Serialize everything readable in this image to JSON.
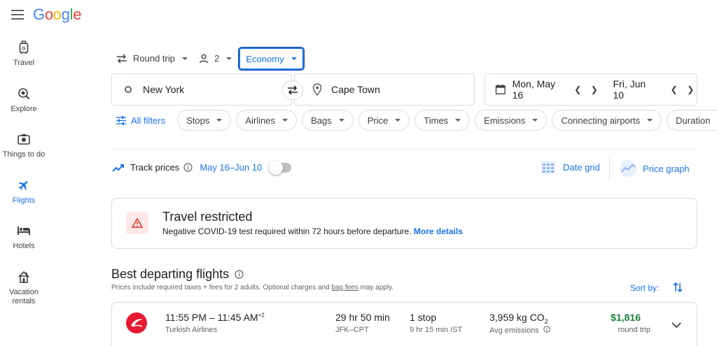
{
  "logo": {
    "letters": [
      "G",
      "o",
      "o",
      "g",
      "l",
      "e"
    ],
    "colors": [
      "#4285f4",
      "#ea4335",
      "#fbbc05",
      "#4285f4",
      "#34a853",
      "#ea4335"
    ]
  },
  "sidebar": {
    "items": [
      {
        "label": "Travel",
        "icon": "luggage-icon"
      },
      {
        "label": "Explore",
        "icon": "explore-icon"
      },
      {
        "label": "Things to do",
        "icon": "camera-icon"
      },
      {
        "label": "Flights",
        "icon": "plane-icon",
        "active": true
      },
      {
        "label": "Hotels",
        "icon": "bed-icon"
      },
      {
        "label": "Vacation rentals",
        "icon": "house-icon"
      }
    ]
  },
  "search": {
    "trip_type": "Round trip",
    "passengers": "2",
    "cabin": "Economy",
    "origin": "New York",
    "destination": "Cape Town",
    "depart_date": "Mon, May 16",
    "return_date": "Fri, Jun 10"
  },
  "filters": {
    "all_filters": "All filters",
    "chips": [
      "Stops",
      "Airlines",
      "Bags",
      "Price",
      "Times",
      "Emissions",
      "Connecting airports",
      "Duration"
    ]
  },
  "track": {
    "label": "Track prices",
    "dates": "May 16–Jun 10",
    "enabled": false
  },
  "views": {
    "date_grid": "Date grid",
    "price_graph": "Price graph"
  },
  "restriction": {
    "title": "Travel restricted",
    "message": "Negative COVID-19 test required within 72 hours before departure.",
    "link": "More details"
  },
  "results": {
    "title": "Best departing flights",
    "subtitle_pre": "Prices include required taxes + fees for 2 adults. Optional charges and ",
    "subtitle_link": "bag fees",
    "subtitle_post": " may apply.",
    "sort_label": "Sort by:",
    "flights": [
      {
        "time": "11:55 PM – 11:45 AM",
        "day_offset": "+2",
        "airline": "Turkish Airlines",
        "duration": "29 hr 50 min",
        "route": "JFK–CPT",
        "stops": "1 stop",
        "layover": "9 hr 15 min IST",
        "emissions": "3,959 kg CO",
        "emissions_sub": "2",
        "emissions_label": "Avg emissions",
        "price": "$1,816",
        "price_type": "round trip"
      }
    ]
  }
}
